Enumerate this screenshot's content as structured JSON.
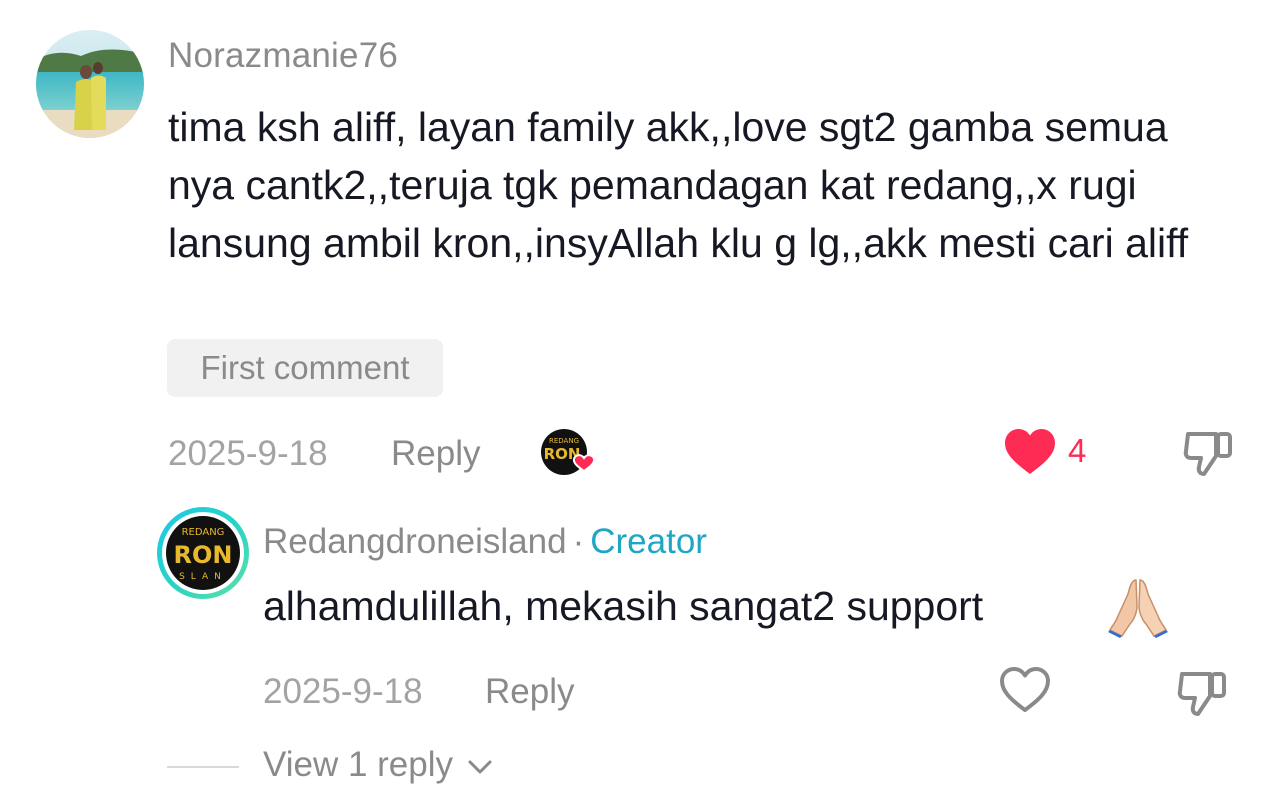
{
  "comment": {
    "username": "Norazmanie76",
    "text": "tima ksh aliff, layan family akk,,love sgt2 gamba semua nya cantk2,,teruja tgk pemandagan kat redang,,x rugi lansung ambil kron,,insyAllah klu g lg,,akk mesti cari aliff",
    "badge": "First comment",
    "date": "2025-9-18",
    "reply_label": "Reply",
    "like_count": "4",
    "liked": true,
    "creator_liked": true
  },
  "reply": {
    "username": "Redangdroneisland",
    "separator": "·",
    "creator_label": "Creator",
    "text": "alhamdulillah, mekasih sangat2 support",
    "emoji": "folded-hands-icon",
    "date": "2025-9-18",
    "reply_label": "Reply",
    "liked": false
  },
  "view_replies_label": "View 1 reply",
  "colors": {
    "like_red": "#fe2c55",
    "creator_blue": "#20a6c4",
    "text_primary": "#161823",
    "text_secondary": "#8a8a8a",
    "badge_bg": "#f1f1f2"
  }
}
